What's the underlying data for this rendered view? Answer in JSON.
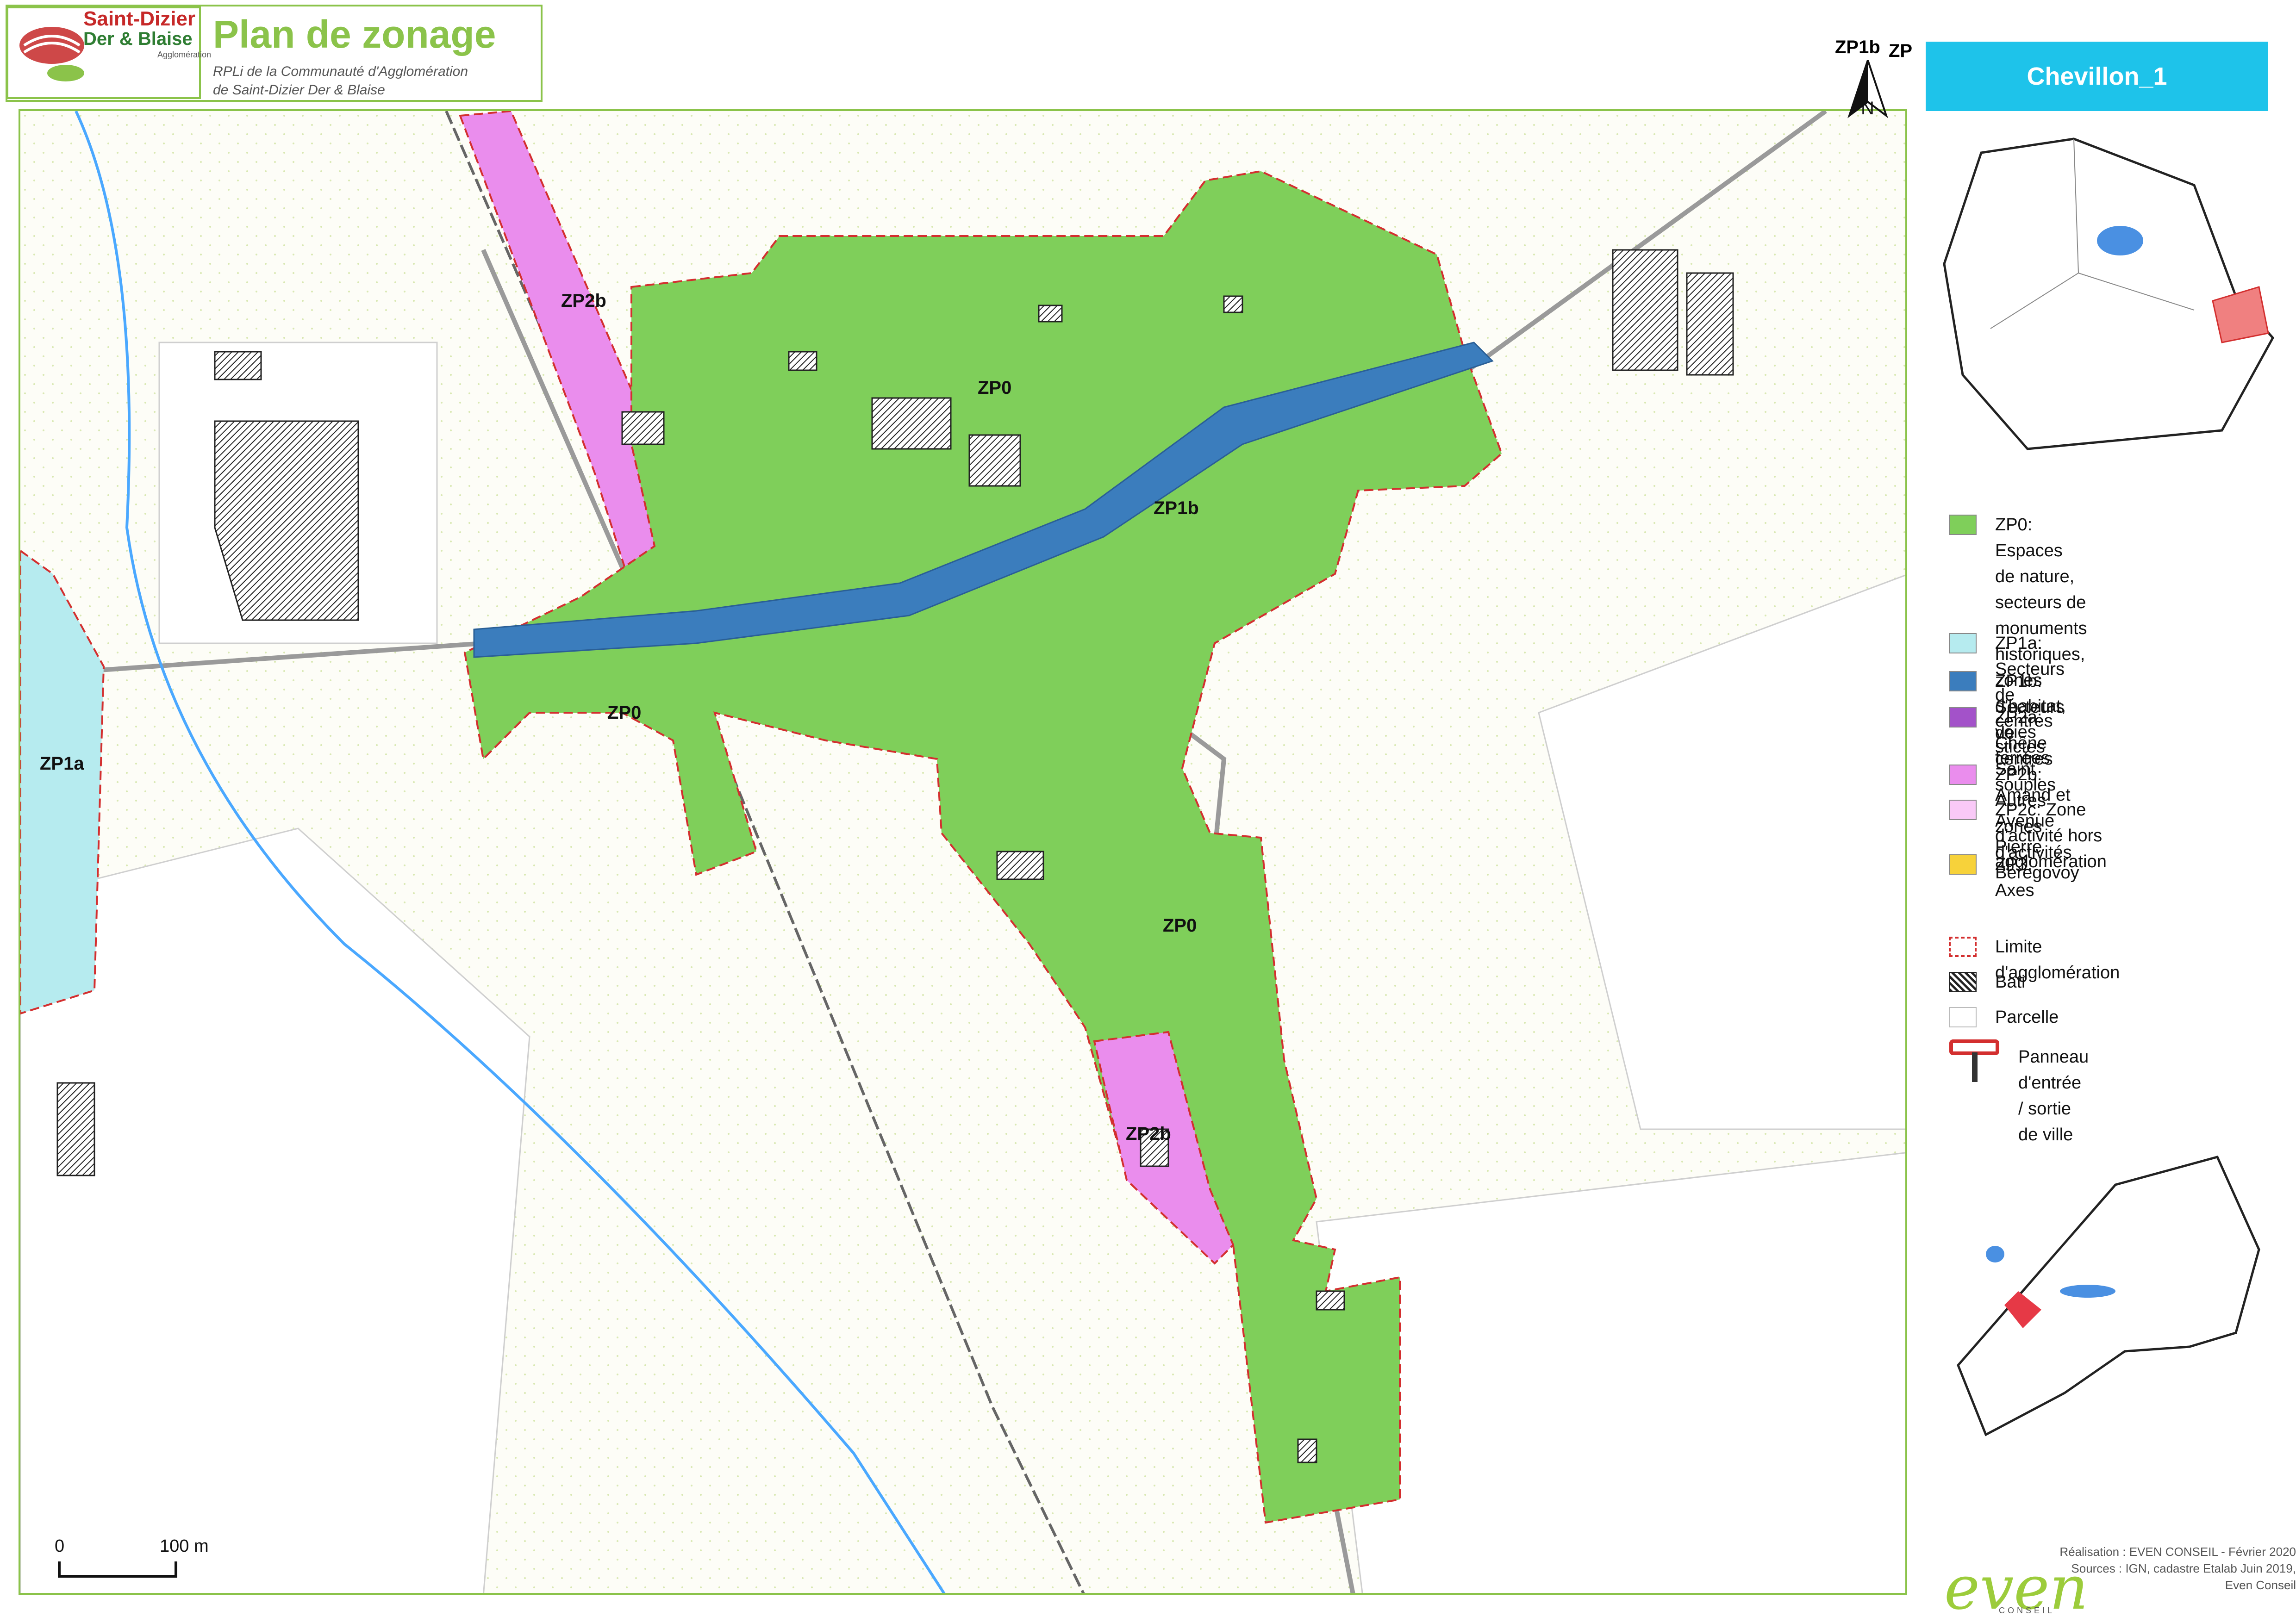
{
  "header": {
    "logo_line1": "Saint-Dizier",
    "logo_line2": "Der & Blaise",
    "logo_line3": "Agglomération",
    "title": "Plan de zonage",
    "subtitle_line1": "RPLi de la Communauté d'Agglomération",
    "subtitle_line2": "de Saint-Dizier Der & Blaise"
  },
  "map": {
    "zone_labels": {
      "zp2b_north": "ZP2b",
      "zp0_center": "ZP0",
      "zp1b_center": "ZP1b",
      "zp0_west": "ZP0",
      "zp1a_west": "ZP1a",
      "zp0_south": "ZP0",
      "zp2b_south": "ZP2b",
      "zp1b_top": "ZP1b",
      "zp_top": "ZP"
    },
    "north_label": "N",
    "scale": {
      "start": "0",
      "end": "100 m"
    }
  },
  "commune": {
    "name": "Chevillon_1"
  },
  "legend": {
    "items": [
      {
        "label": "ZP0: Espaces de nature,\nsecteurs de monuments\nhistoriques, zones d'habitat,\nvoies ferrées",
        "color": "#7fcf5a"
      },
      {
        "label": "ZP1a: Secteurs de centres stictes",
        "color": "#b6ebef"
      },
      {
        "label": "ZP1b: Secteurs de centres souples",
        "color": "#3b7dbd"
      },
      {
        "label": "ZP2a: Chêne Saint Amand et\nAvenue Pierre Beregovoy",
        "color": "#a352c9"
      },
      {
        "label": "ZP2b: Autres zones d'activités",
        "color": "#ea8ded"
      },
      {
        "label": "ZP2c: Zone d'activité hors\nagglomération",
        "color": "#f9c9f7"
      },
      {
        "label": "ZP3: Axes",
        "color": "#f7d23a"
      }
    ],
    "limit_label": "Limite d'agglomération",
    "bati_label": "Bati",
    "parcelle_label": "Parcelle",
    "panneau_label": "Panneau d'entrée / sortie de ville"
  },
  "credits": {
    "line1": "Réalisation : EVEN CONSEIL - Février 2020",
    "line2": "Sources : IGN, cadastre Etalab Juin 2019,",
    "line3": "Even Conseil",
    "logo": "even",
    "logo_sub": "CONSEIL"
  }
}
